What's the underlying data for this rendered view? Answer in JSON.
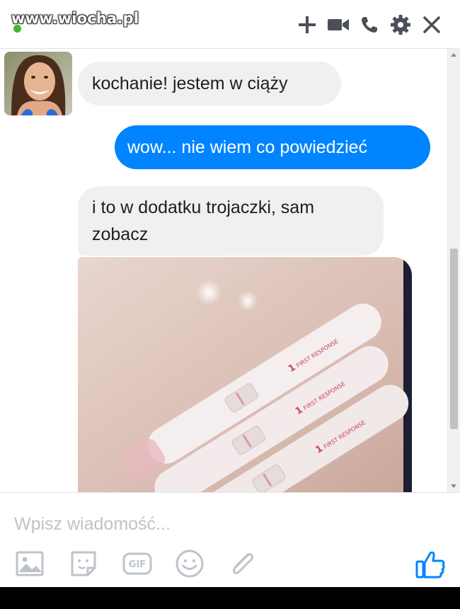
{
  "header": {
    "watermark": "www.wiocha.pl",
    "icons": [
      "add-icon",
      "video-call-icon",
      "phone-icon",
      "settings-icon",
      "close-icon"
    ]
  },
  "messages": [
    {
      "direction": "incoming",
      "text": "kochanie! jestem w ciąży"
    },
    {
      "direction": "outgoing",
      "text": "wow... nie wiem co powiedzieć"
    },
    {
      "direction": "incoming",
      "text": "i to w dodatku trojaczki, sam zobacz"
    }
  ],
  "photo": {
    "test_brand_text": "FIRST RESPONSE"
  },
  "composer": {
    "placeholder": "Wpisz wiadomość...",
    "tools": [
      "image-icon",
      "sticker-icon",
      "gif-icon",
      "emoji-icon",
      "attachment-icon",
      "like-icon"
    ],
    "gif_label": "GIF"
  },
  "colors": {
    "outgoing_bubble": "#0084ff",
    "incoming_bubble": "#f1f0f0",
    "online_indicator": "#42b72a",
    "icon_gray": "#4b4f56",
    "icon_light": "#bec3c9"
  }
}
